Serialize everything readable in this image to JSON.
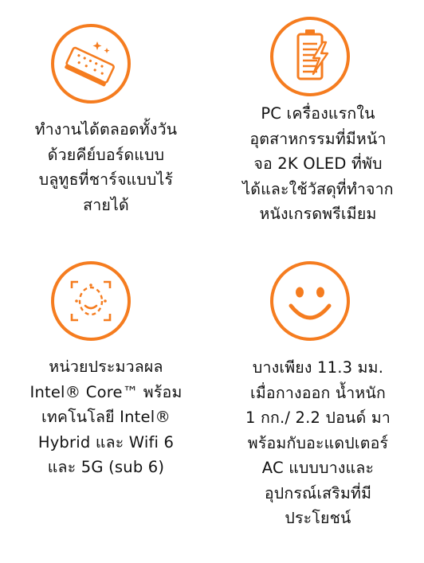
{
  "theme": {
    "accent": "#f57c1f",
    "text": "#111111",
    "background": "#ffffff"
  },
  "features": [
    {
      "icon": "keyboard-icon",
      "lines": [
        "ทำงานได้ตลอดทั้งวัน",
        "ด้วยคีย์บอร์ดแบบ",
        "บลูทูธที่ชาร์จแบบไร้",
        "สายได้"
      ]
    },
    {
      "icon": "battery-charging-icon",
      "lines": [
        "PC เครื่องแรกใน",
        "อุตสาหกรรมที่มีหน้า",
        "จอ 2K OLED ที่พับ",
        "ได้และใช้วัสดุที่ทำจาก",
        "หนังเกรดพรีเมียม"
      ]
    },
    {
      "icon": "face-recognition-icon",
      "lines": [
        "หน่วยประมวลผล",
        "Intel® Core™ พร้อม",
        "เทคโนโลยี Intel®",
        "Hybrid และ Wifi 6",
        "และ 5G (sub 6)"
      ]
    },
    {
      "icon": "smiley-face-icon",
      "lines": [
        "บางเพียง 11.3 มม.",
        "เมื่อกางออก น้ำหนัก",
        "1 กก./ 2.2 ปอนด์ มา",
        "พร้อมกับอะแดปเตอร์",
        "AC แบบบางและ",
        "อุปกรณ์เสริมที่มี",
        "ประโยชน์"
      ]
    }
  ]
}
